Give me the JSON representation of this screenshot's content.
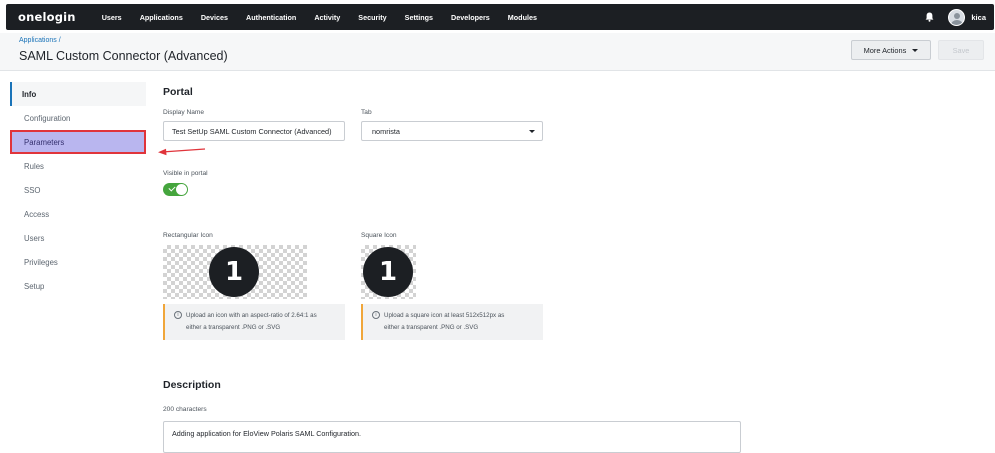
{
  "nav": {
    "logo": "onelogin",
    "items": [
      "Users",
      "Applications",
      "Devices",
      "Authentication",
      "Activity",
      "Security",
      "Settings",
      "Developers",
      "Modules"
    ],
    "username": "kica",
    "icons": [
      "bell-icon",
      "avatar"
    ]
  },
  "header": {
    "breadcrumb": "Applications /",
    "title": "SAML Custom Connector (Advanced)",
    "more_actions": "More Actions",
    "save": "Save"
  },
  "sidebar": {
    "items": [
      "Info",
      "Configuration",
      "Parameters",
      "Rules",
      "SSO",
      "Access",
      "Users",
      "Privileges",
      "Setup"
    ],
    "active": "Info",
    "highlighted": "Parameters",
    "highlight_color": "#e0343b"
  },
  "portal": {
    "title": "Portal",
    "display_name_label": "Display Name",
    "display_name_value": "Test SetUp SAML Custom Connector (Advanced)",
    "tab_label": "Tab",
    "tab_value": "nomrista",
    "visible_label": "Visible in portal",
    "visible_on": true,
    "toggle_color": "#45a53d",
    "rect_icon_label": "Rectangular Icon",
    "square_icon_label": "Square Icon",
    "icon_glyph": "1",
    "rect_info_line1": "Upload an icon with an aspect-ratio of 2.64:1 as",
    "rect_info_line2": "either a transparent .PNG or .SVG",
    "square_info_line1": "Upload a square icon at least 512x512px as",
    "square_info_line2": "either a transparent .PNG or .SVG"
  },
  "description": {
    "title": "Description",
    "counter": "200 characters",
    "value": "Adding application for EloView Polaris SAML Configuration."
  },
  "annotation": {
    "arrow_color": "#e0343b"
  }
}
